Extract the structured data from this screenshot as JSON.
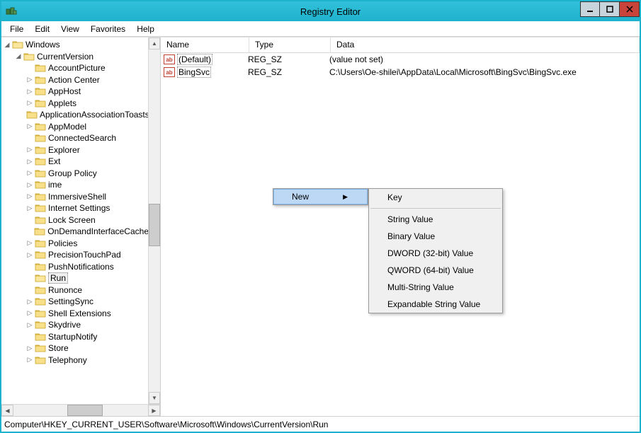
{
  "window": {
    "title": "Registry Editor"
  },
  "menubar": {
    "items": [
      "File",
      "Edit",
      "View",
      "Favorites",
      "Help"
    ]
  },
  "tree": {
    "root": "Windows",
    "expanded": "CurrentVersion",
    "children": [
      {
        "label": "AccountPicture",
        "expandable": false
      },
      {
        "label": "Action Center",
        "expandable": true
      },
      {
        "label": "AppHost",
        "expandable": true
      },
      {
        "label": "Applets",
        "expandable": true
      },
      {
        "label": "ApplicationAssociationToasts",
        "expandable": false
      },
      {
        "label": "AppModel",
        "expandable": true
      },
      {
        "label": "ConnectedSearch",
        "expandable": false
      },
      {
        "label": "Explorer",
        "expandable": true
      },
      {
        "label": "Ext",
        "expandable": true
      },
      {
        "label": "Group Policy",
        "expandable": true
      },
      {
        "label": "ime",
        "expandable": true
      },
      {
        "label": "ImmersiveShell",
        "expandable": true
      },
      {
        "label": "Internet Settings",
        "expandable": true
      },
      {
        "label": "Lock Screen",
        "expandable": false
      },
      {
        "label": "OnDemandInterfaceCache",
        "expandable": false
      },
      {
        "label": "Policies",
        "expandable": true
      },
      {
        "label": "PrecisionTouchPad",
        "expandable": true
      },
      {
        "label": "PushNotifications",
        "expandable": false
      },
      {
        "label": "Run",
        "expandable": false,
        "selected": true
      },
      {
        "label": "Runonce",
        "expandable": false
      },
      {
        "label": "SettingSync",
        "expandable": true
      },
      {
        "label": "Shell Extensions",
        "expandable": true
      },
      {
        "label": "Skydrive",
        "expandable": true
      },
      {
        "label": "StartupNotify",
        "expandable": false
      },
      {
        "label": "Store",
        "expandable": true
      },
      {
        "label": "Telephony",
        "expandable": true
      }
    ]
  },
  "list": {
    "columns": {
      "name": "Name",
      "type": "Type",
      "data": "Data"
    },
    "rows": [
      {
        "name": "(Default)",
        "type": "REG_SZ",
        "data": "(value not set)"
      },
      {
        "name": "BingSvc",
        "type": "REG_SZ",
        "data": "C:\\Users\\Oe-shilei\\AppData\\Local\\Microsoft\\BingSvc\\BingSvc.exe"
      }
    ]
  },
  "contextmenu": {
    "new": "New",
    "submenu": [
      "Key",
      "String Value",
      "Binary Value",
      "DWORD (32-bit) Value",
      "QWORD (64-bit) Value",
      "Multi-String Value",
      "Expandable String Value"
    ]
  },
  "statusbar": {
    "path": "Computer\\HKEY_CURRENT_USER\\Software\\Microsoft\\Windows\\CurrentVersion\\Run"
  }
}
